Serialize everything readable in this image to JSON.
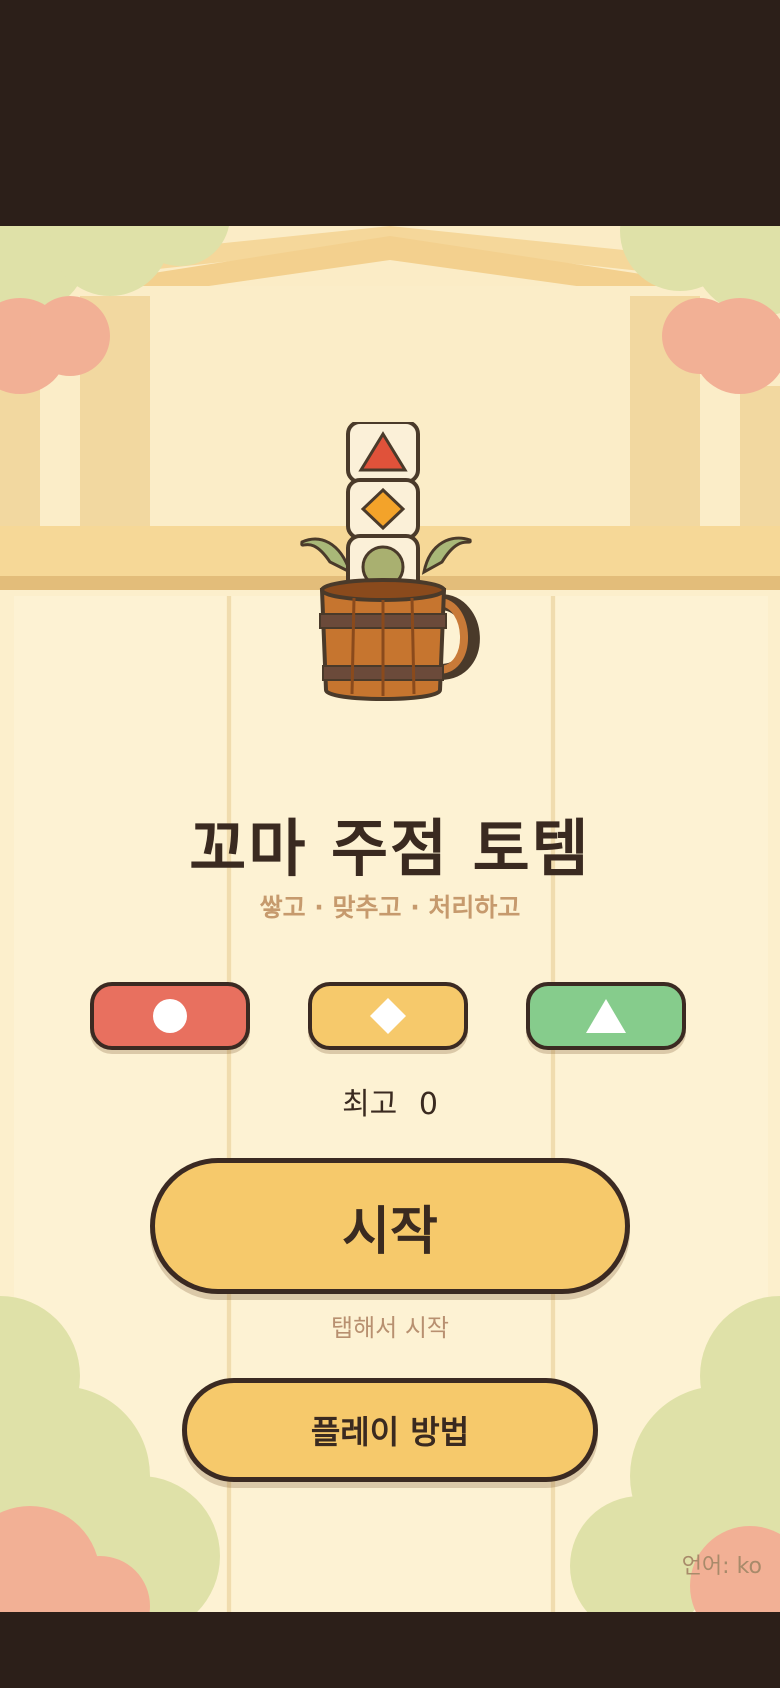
{
  "game": {
    "title": "꼬마 주점 토템",
    "subtitle": "쌓고 · 맞추고 · 처리하고",
    "logo_icon": "totem-mug-icon"
  },
  "shape_buttons": [
    {
      "shape": "circle",
      "icon": "circle-icon",
      "color": "#e8705f"
    },
    {
      "shape": "diamond",
      "icon": "diamond-icon",
      "color": "#f6c96b"
    },
    {
      "shape": "triangle",
      "icon": "triangle-icon",
      "color": "#86cc8c"
    }
  ],
  "score": {
    "best_label": "최고",
    "best_value": "0"
  },
  "start": {
    "label": "시작",
    "hint": "탭해서 시작"
  },
  "howto": {
    "label": "플레이 방법"
  },
  "language": {
    "label": "언어: ko"
  }
}
